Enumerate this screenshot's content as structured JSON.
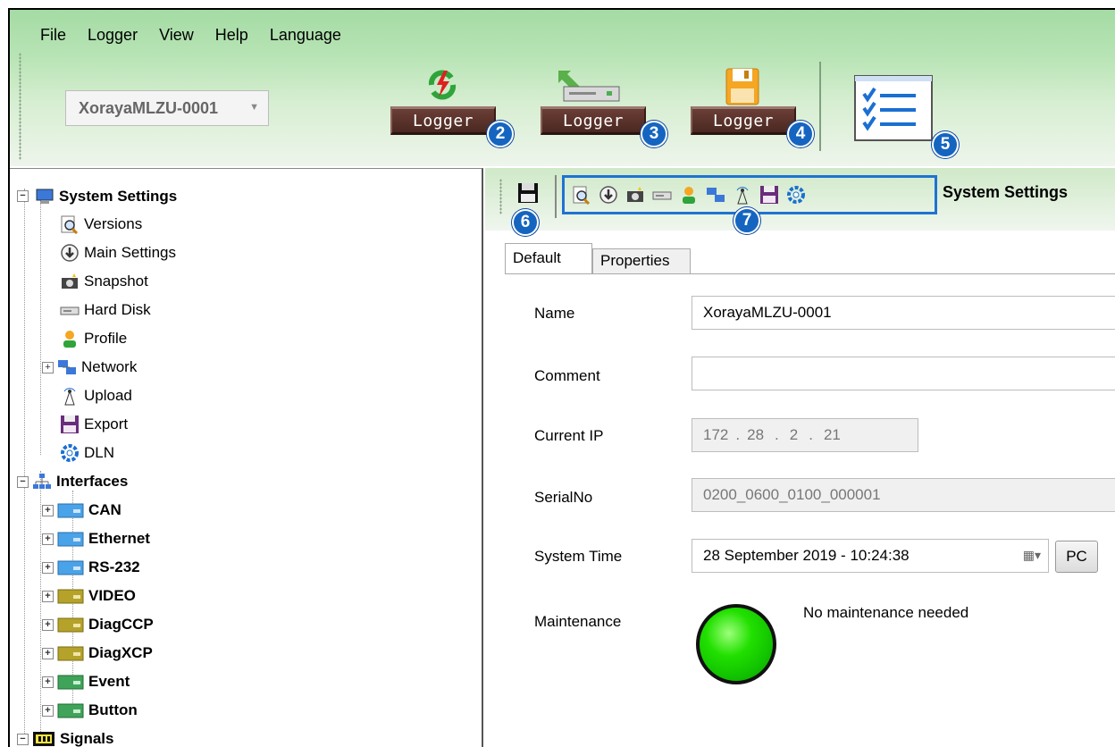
{
  "menu": [
    "File",
    "Logger",
    "View",
    "Help",
    "Language"
  ],
  "device_combo": {
    "value": "XorayaMLZU-0001"
  },
  "logger_buttons": [
    {
      "label": "Logger",
      "badge": "2",
      "icon": "connect-icon"
    },
    {
      "label": "Logger",
      "badge": "3",
      "icon": "download-to-device-icon"
    },
    {
      "label": "Logger",
      "badge": "4",
      "icon": "save-icon"
    }
  ],
  "checklist_badge": "5",
  "tree": {
    "system_settings": "System Settings",
    "versions": "Versions",
    "main_settings": "Main Settings",
    "snapshot": "Snapshot",
    "hard_disk": "Hard Disk",
    "profile": "Profile",
    "network": "Network",
    "upload": "Upload",
    "export": "Export",
    "dln": "DLN",
    "interfaces": "Interfaces",
    "can": "CAN",
    "ethernet": "Ethernet",
    "rs232": "RS-232",
    "video": "VIDEO",
    "diagccp": "DiagCCP",
    "diagxcp": "DiagXCP",
    "event": "Event",
    "button": "Button",
    "signals": "Signals"
  },
  "panel": {
    "save_badge": "6",
    "strip_badge": "7",
    "title": "System Settings",
    "tabs": [
      "Default",
      "Properties"
    ]
  },
  "form": {
    "name_label": "Name",
    "name_value": "XorayaMLZU-0001",
    "comment_label": "Comment",
    "comment_value": "",
    "ip_label": "Current IP",
    "ip": [
      "172",
      "28",
      "2",
      "21"
    ],
    "serial_label": "SerialNo",
    "serial_value": "0200_0600_0100_000001",
    "time_label": "System Time",
    "time_value": "28 September 2019 - 10:24:38",
    "pc_label": "PC",
    "maint_label": "Maintenance",
    "maint_status": "No maintenance needed",
    "maint_color": "#22e000"
  }
}
